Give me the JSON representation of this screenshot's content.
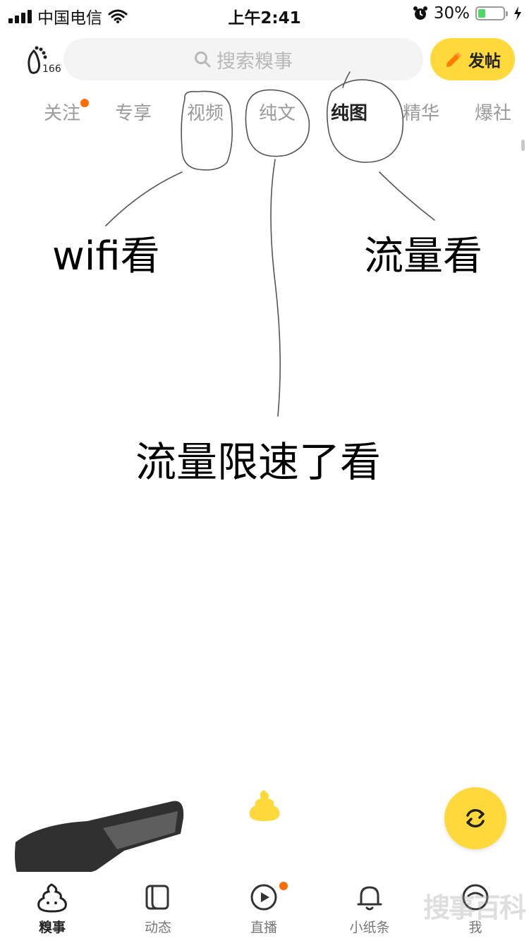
{
  "status_bar": {
    "carrier": "中国电信",
    "time": "上午2:41",
    "battery_percent": "30%",
    "battery_level": 0.3
  },
  "header": {
    "logo_count": "166",
    "search_placeholder": "搜索糗事",
    "post_label": "发帖"
  },
  "tabs": [
    {
      "label": "关注",
      "badge": true
    },
    {
      "label": "专享"
    },
    {
      "label": "视频"
    },
    {
      "label": "纯文"
    },
    {
      "label": "纯图",
      "active": true
    },
    {
      "label": "精华"
    },
    {
      "label": "爆社"
    }
  ],
  "annotations": {
    "wifi": "wifi看",
    "data": "流量看",
    "throttled": "流量限速了看"
  },
  "bottom_nav": [
    {
      "label": "糗事",
      "icon": "poop-icon",
      "active": true
    },
    {
      "label": "动态",
      "icon": "book-icon"
    },
    {
      "label": "直播",
      "icon": "play-icon",
      "badge": true
    },
    {
      "label": "小纸条",
      "icon": "bell-icon"
    },
    {
      "label": "我",
      "icon": "face-icon"
    }
  ],
  "watermark": "搜事百科",
  "colors": {
    "accent_yellow": "#ffd93b",
    "badge_orange": "#ff6b00",
    "battery_green": "#4cd964"
  }
}
